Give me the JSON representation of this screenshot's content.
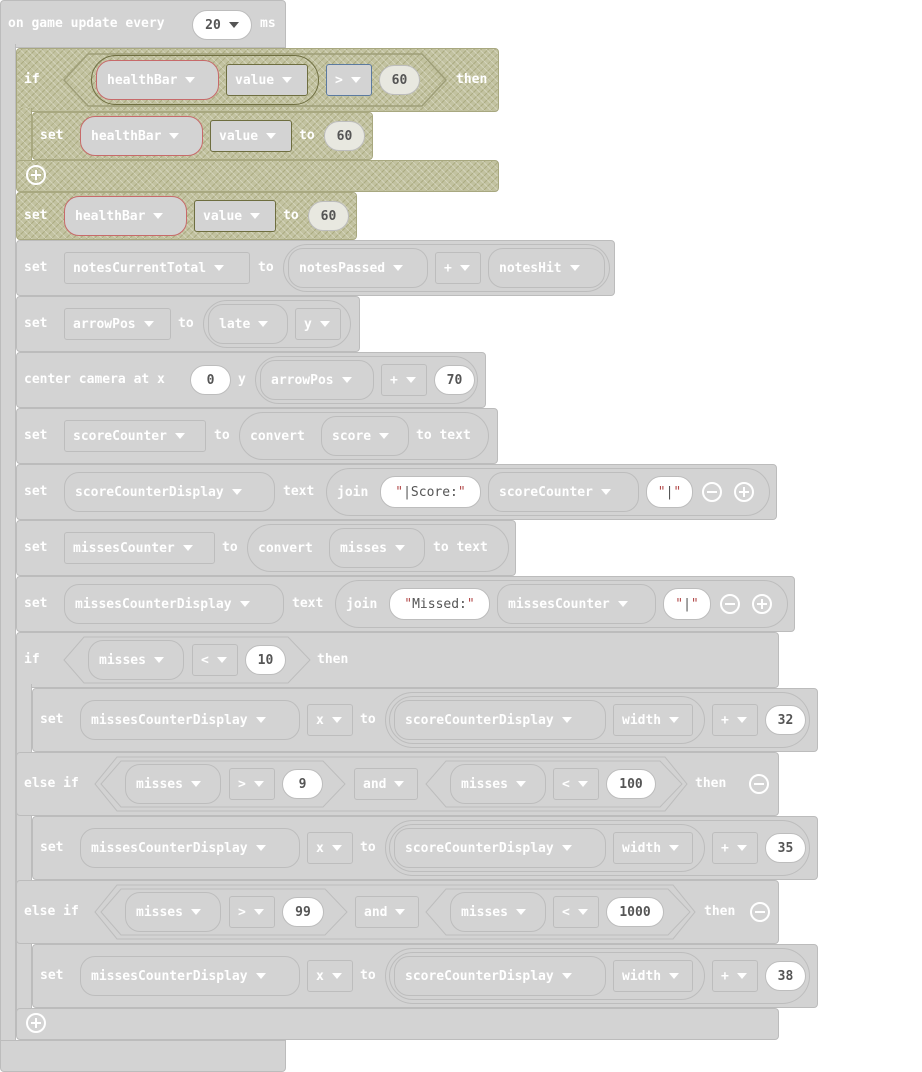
{
  "onupdate": {
    "label": "on game update every",
    "interval": "20",
    "unit": "ms"
  },
  "kw": {
    "if": "if",
    "then": "then",
    "set": "set",
    "to": "to",
    "text": "text",
    "join": "join",
    "convert": "convert",
    "to_text": "to text",
    "center": "center camera at x",
    "y": "y",
    "else_if": "else if",
    "and": "and"
  },
  "b1": {
    "sprite": "healthBar",
    "prop": "value",
    "op": ">",
    "num": "60"
  },
  "b2": {
    "sprite": "healthBar",
    "prop": "value",
    "num": "60"
  },
  "b3": {
    "sprite": "healthBar",
    "prop": "value",
    "num": "60"
  },
  "b4": {
    "var": "notesCurrentTotal",
    "a": "notesPassed",
    "op": "+",
    "b": "notesHit"
  },
  "b5": {
    "var": "arrowPos",
    "a": "late",
    "b": "y"
  },
  "b6": {
    "x": "0",
    "a": "arrowPos",
    "op": "+",
    "num": "70"
  },
  "b7": {
    "var": "scoreCounter",
    "src": "score"
  },
  "b8": {
    "var": "scoreCounterDisplay",
    "s1": "|Score:",
    "mid": "scoreCounter",
    "s2": "|"
  },
  "b9": {
    "var": "missesCounter",
    "src": "misses"
  },
  "b10": {
    "var": "missesCounterDisplay",
    "s1": "Missed:",
    "mid": "missesCounter",
    "s2": "|"
  },
  "c1": {
    "a": "misses",
    "op": "<",
    "num": "10"
  },
  "s1": {
    "var": "missesCounterDisplay",
    "prop": "x",
    "src": "scoreCounterDisplay",
    "sprop": "width",
    "op": "+",
    "num": "32"
  },
  "c2": {
    "a": "misses",
    "op1": ">",
    "n1": "9",
    "b": "misses",
    "op2": "<",
    "n2": "100"
  },
  "s2": {
    "var": "missesCounterDisplay",
    "prop": "x",
    "src": "scoreCounterDisplay",
    "sprop": "width",
    "op": "+",
    "num": "35"
  },
  "c3": {
    "a": "misses",
    "op1": ">",
    "n1": "99",
    "b": "misses",
    "op2": "<",
    "n2": "1000"
  },
  "s3": {
    "var": "missesCounterDisplay",
    "prop": "x",
    "src": "scoreCounterDisplay",
    "sprop": "width",
    "op": "+",
    "num": "38"
  },
  "colors": {
    "block": "#d3d3d3",
    "disabled": "#c2c2a0",
    "text": "#ffffff"
  }
}
